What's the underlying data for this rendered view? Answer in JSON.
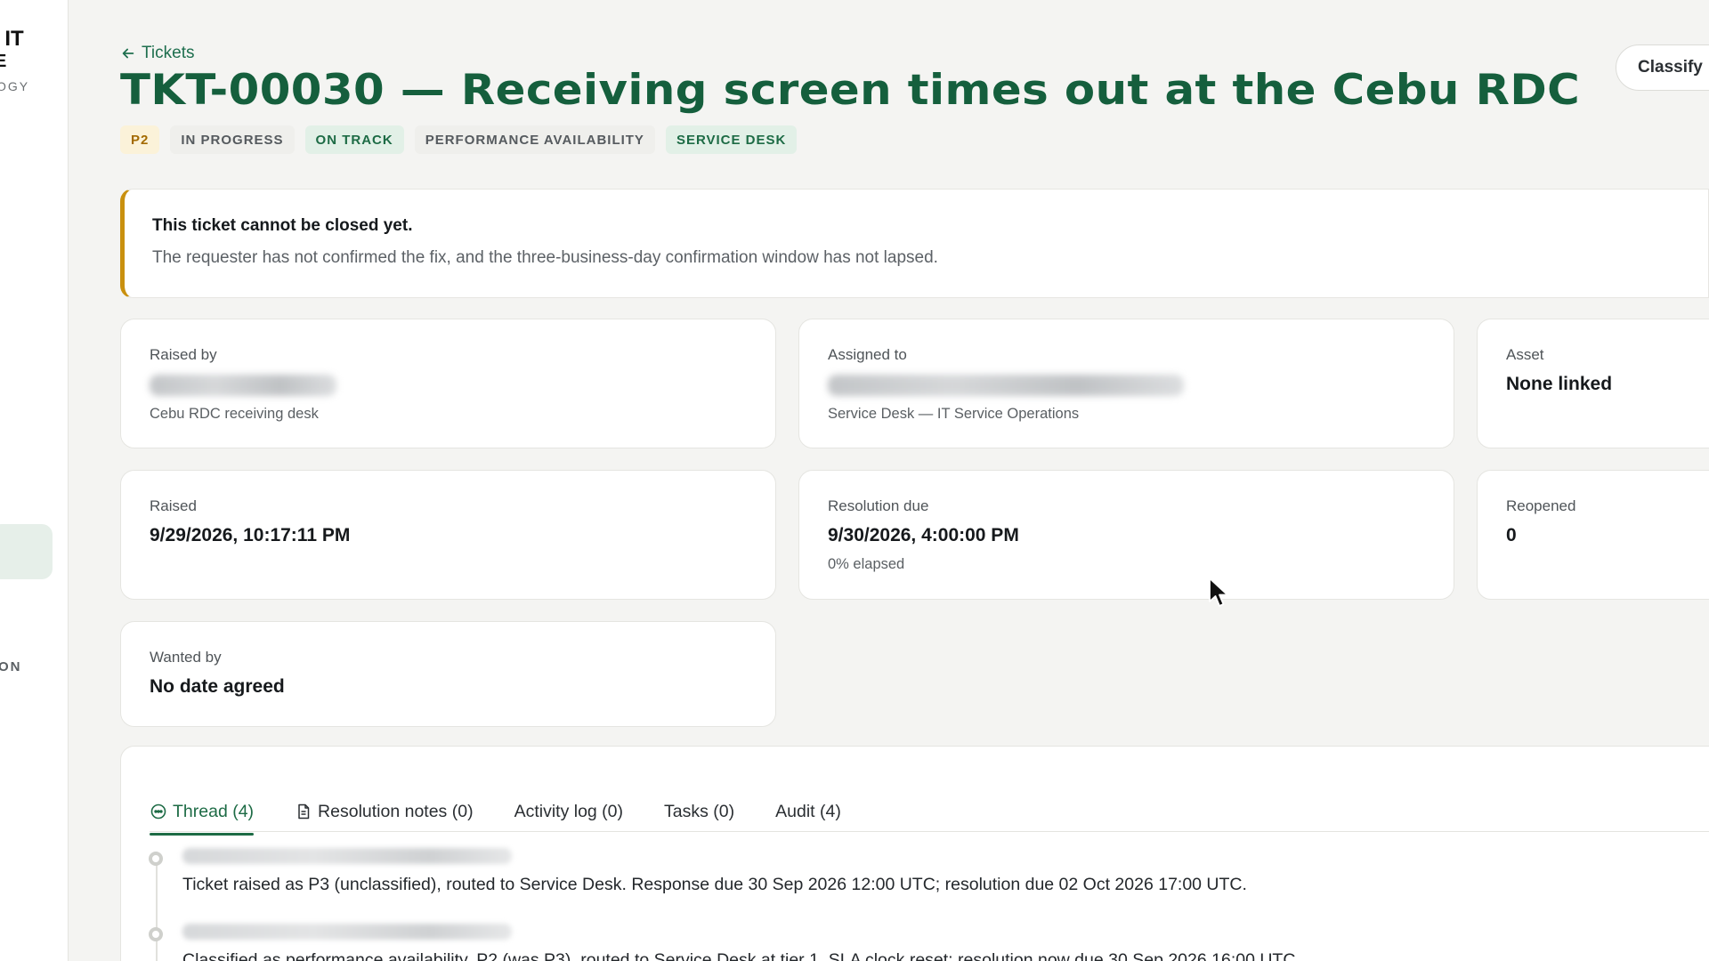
{
  "sidebar": {
    "brand_line1": "l IT",
    "brand_line2": "E",
    "brand_line3": "OGY",
    "section_label": "ON"
  },
  "header": {
    "back_label": "Tickets",
    "title": "TKT-00030 — Receiving screen times out at the Cebu RDC",
    "classify_label": "Classify",
    "badges": [
      "P2",
      "IN PROGRESS",
      "ON TRACK",
      "PERFORMANCE AVAILABILITY",
      "SERVICE DESK"
    ]
  },
  "alert": {
    "title": "This ticket cannot be closed yet.",
    "text": "The requester has not confirmed the fix, and the three-business-day confirmation window has not lapsed."
  },
  "cards": {
    "raised_by": {
      "label": "Raised by",
      "sub": "Cebu RDC receiving desk"
    },
    "assigned_to": {
      "label": "Assigned to",
      "sub": "Service Desk — IT Service Operations"
    },
    "asset": {
      "label": "Asset",
      "value": "None linked"
    },
    "raised": {
      "label": "Raised",
      "value": "9/29/2026, 10:17:11 PM"
    },
    "resolution_due": {
      "label": "Resolution due",
      "value": "9/30/2026, 4:00:00 PM",
      "sub": "0% elapsed"
    },
    "reopened": {
      "label": "Reopened",
      "value": "0"
    },
    "wanted_by": {
      "label": "Wanted by",
      "value": "No date agreed"
    }
  },
  "tabs": [
    {
      "label": "Thread (4)",
      "icon": "chat-bubble-icon",
      "active": true
    },
    {
      "label": "Resolution notes (0)",
      "icon": "document-icon",
      "active": false
    },
    {
      "label": "Activity log (0)",
      "active": false
    },
    {
      "label": "Tasks (0)",
      "active": false
    },
    {
      "label": "Audit (4)",
      "active": false
    }
  ],
  "thread": [
    {
      "text": "Ticket raised as P3 (unclassified), routed to Service Desk. Response due 30 Sep 2026 12:00 UTC; resolution due 02 Oct 2026 17:00 UTC."
    },
    {
      "text": "Classified as performance availability, P2 (was P3), routed to Service Desk at tier 1. SLA clock reset; resolution now due 30 Sep 2026 16:00 UTC."
    }
  ],
  "colors": {
    "accent": "#1d6b45",
    "title": "#155f3d",
    "warning_border": "#c9900f",
    "priority_bg": "#fbf2d9"
  }
}
